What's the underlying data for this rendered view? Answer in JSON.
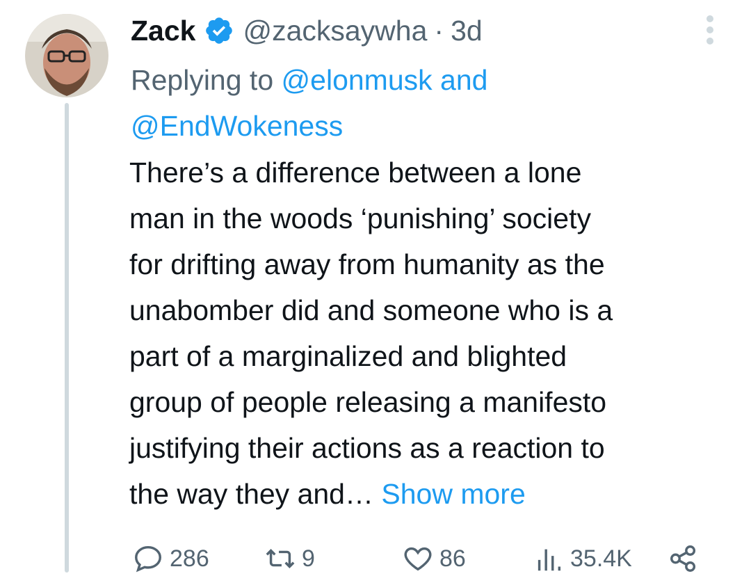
{
  "tweet": {
    "author": {
      "name": "Zack",
      "handle": "@zacksaywha",
      "separator": "·",
      "time": "3d",
      "verified_icon": "verified-badge-icon"
    },
    "replying": {
      "prefix": "Replying to",
      "mention1": "@elonmusk",
      "conj": "and",
      "mention2": "@EndWokeness"
    },
    "body_lines": [
      "There’s a difference between a lone",
      "man in the woods ‘punishing’ society",
      "for drifting away from humanity as the",
      "unabomber did and someone who is a",
      "part of a marginalized and blighted",
      "group of people releasing a manifesto",
      "justifying their actions as a reaction to",
      "the way they and…"
    ],
    "show_more": "Show more",
    "stats": {
      "replies": "286",
      "retweets": "9",
      "likes": "86",
      "views": "35.4K"
    }
  },
  "colors": {
    "link": "#1d9bf0",
    "muted": "#536471",
    "thread_line": "#cfd9de",
    "text": "#0f1419"
  }
}
